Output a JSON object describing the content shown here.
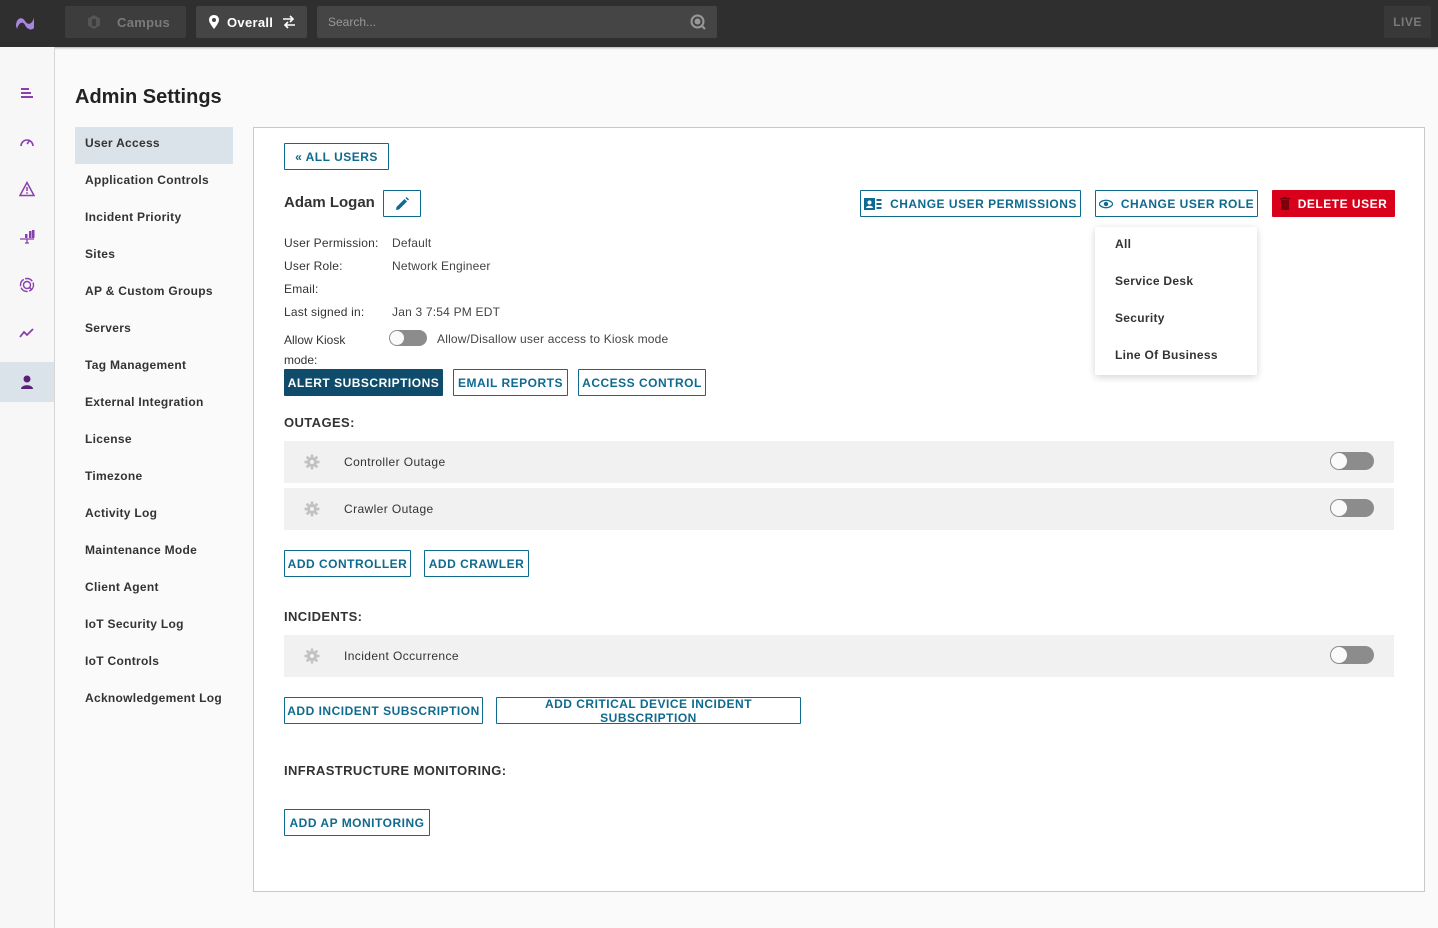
{
  "topbar": {
    "campus_label": "Campus",
    "overall_label": "Overall",
    "search_placeholder": "Search...",
    "live_label": "LIVE"
  },
  "rail": {
    "items": [
      {
        "icon": "menu-icon"
      },
      {
        "icon": "dashboard-gauge-icon"
      },
      {
        "icon": "alert-triangle-icon"
      },
      {
        "icon": "analytics-icon"
      },
      {
        "icon": "search-target-icon"
      },
      {
        "icon": "trend-line-icon"
      },
      {
        "icon": "user-icon",
        "active": true
      }
    ]
  },
  "page": {
    "title": "Admin Settings"
  },
  "settings_nav": {
    "items": [
      {
        "label": "User Access",
        "active": true
      },
      {
        "label": "Application Controls"
      },
      {
        "label": "Incident Priority"
      },
      {
        "label": "Sites"
      },
      {
        "label": "AP & Custom Groups"
      },
      {
        "label": "Servers"
      },
      {
        "label": "Tag Management"
      },
      {
        "label": "External Integration"
      },
      {
        "label": "License"
      },
      {
        "label": "Timezone"
      },
      {
        "label": "Activity Log"
      },
      {
        "label": "Maintenance Mode"
      },
      {
        "label": "Client Agent"
      },
      {
        "label": "IoT Security Log"
      },
      {
        "label": "IoT Controls"
      },
      {
        "label": "Acknowledgement Log"
      }
    ]
  },
  "user": {
    "all_users_label": "« ALL USERS",
    "name": "Adam Logan",
    "change_permissions_label": "CHANGE USER PERMISSIONS",
    "change_role_label": "CHANGE USER ROLE",
    "delete_label": "DELETE USER",
    "fields": {
      "permission_label": "User Permission:",
      "permission_value": "Default",
      "role_label": "User Role:",
      "role_value": "Network Engineer",
      "email_label": "Email:",
      "email_value": "",
      "last_signed_label": "Last signed in:",
      "last_signed_value": "Jan 3 7:54 PM EDT"
    },
    "kiosk": {
      "label": "Allow Kiosk mode:",
      "enabled": false,
      "description": "Allow/Disallow user access to Kiosk mode"
    }
  },
  "role_dropdown": {
    "options": [
      "All",
      "Service Desk",
      "Security",
      "Line Of Business"
    ]
  },
  "tabs": [
    {
      "label": "ALERT SUBSCRIPTIONS",
      "active": true
    },
    {
      "label": "EMAIL REPORTS"
    },
    {
      "label": "ACCESS CONTROL"
    }
  ],
  "outages": {
    "title": "OUTAGES:",
    "items": [
      {
        "name": "Controller Outage",
        "enabled": false
      },
      {
        "name": "Crawler Outage",
        "enabled": false
      }
    ],
    "add_controller_label": "ADD CONTROLLER",
    "add_crawler_label": "ADD CRAWLER"
  },
  "incidents": {
    "title": "INCIDENTS:",
    "items": [
      {
        "name": "Incident Occurrence",
        "enabled": false
      }
    ],
    "add_incident_label": "ADD INCIDENT SUBSCRIPTION",
    "add_critical_label": "ADD CRITICAL DEVICE INCIDENT SUBSCRIPTION"
  },
  "infrastructure": {
    "title": "INFRASTRUCTURE MONITORING:",
    "add_ap_label": "ADD AP MONITORING"
  },
  "colors": {
    "accent": "#0f6a8f",
    "accent_filled": "#0f4c6b",
    "danger": "#d9001b",
    "brand": "#9b72d6",
    "rail_icon": "#8a3fb0"
  }
}
